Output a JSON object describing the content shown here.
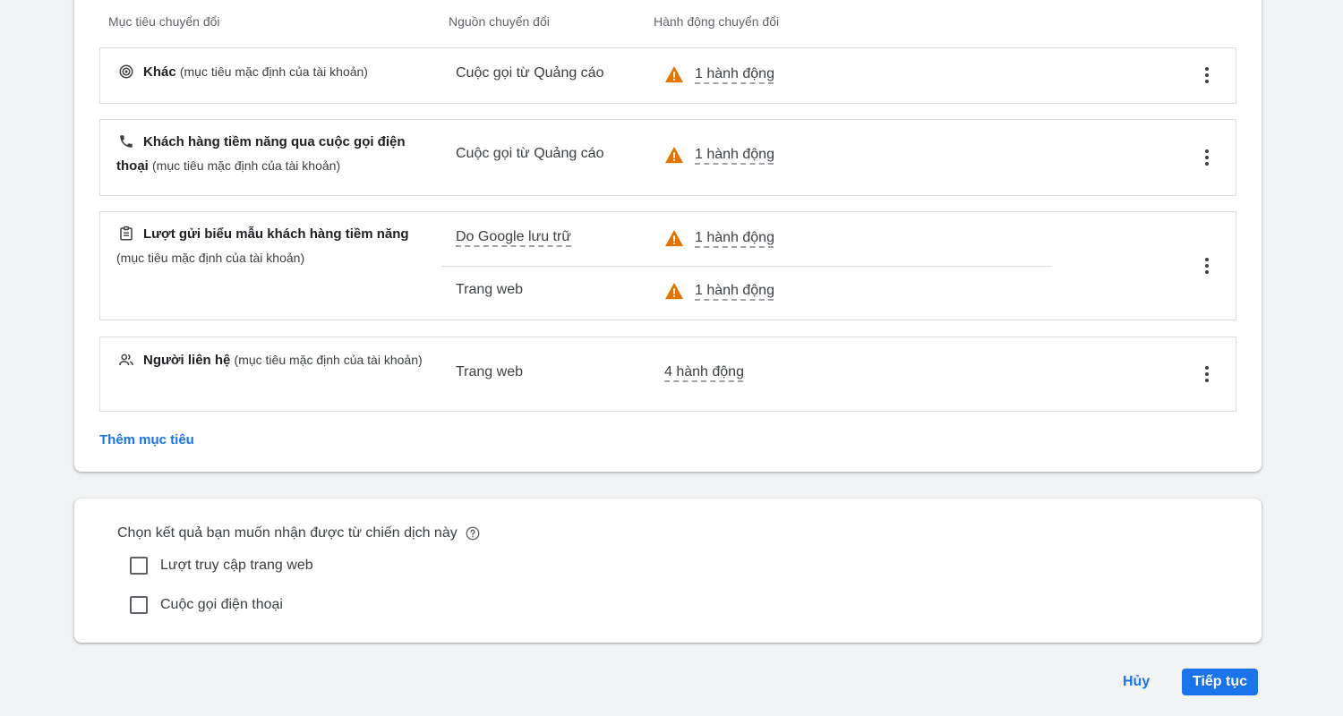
{
  "headers": {
    "goal": "Mục tiêu chuyển đổi",
    "source": "Nguồn chuyển đổi",
    "action": "Hành động chuyển đổi"
  },
  "goals": [
    {
      "icon": "target-icon",
      "name": "Khác",
      "sub": "(mục tiêu mặc định của tài khoản)",
      "rows": [
        {
          "source": "Cuộc gọi từ Quảng cáo",
          "action": "1 hành động",
          "warning": true
        }
      ]
    },
    {
      "icon": "phone-icon",
      "name": "Khách hàng tiềm năng qua cuộc gọi điện thoại",
      "sub": "(mục tiêu mặc định của tài khoản)",
      "rows": [
        {
          "source": "Cuộc gọi từ Quảng cáo",
          "action": "1 hành động",
          "warning": true
        }
      ]
    },
    {
      "icon": "clipboard-icon",
      "name": "Lượt gửi biểu mẫu khách hàng tiềm năng",
      "sub": "(mục tiêu mặc định của tài khoản)",
      "rows": [
        {
          "source": "Do Google lưu trữ",
          "action": "1 hành động",
          "warning": true
        },
        {
          "source": "Trang web",
          "action": "1 hành động",
          "warning": true
        }
      ]
    },
    {
      "icon": "people-icon",
      "name": "Người liên hệ",
      "sub": "(mục tiêu mặc định của tài khoản)",
      "rows": [
        {
          "source": "Trang web",
          "action": "4 hành động",
          "warning": false
        }
      ]
    }
  ],
  "add_goal_label": "Thêm mục tiêu",
  "results": {
    "question": "Chọn kết quả bạn muốn nhận được từ chiến dịch này",
    "options": [
      {
        "label": "Lượt truy cập trang web",
        "checked": false
      },
      {
        "label": "Cuộc gọi điện thoại",
        "checked": false
      }
    ]
  },
  "footer": {
    "cancel": "Hủy",
    "continue": "Tiếp tục"
  },
  "colors": {
    "accent": "#1a73e8",
    "warning": "#e37400",
    "border": "#dadce0"
  }
}
